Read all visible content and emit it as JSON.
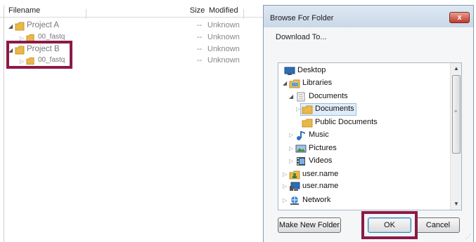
{
  "file_list": {
    "columns": {
      "filename": "Filename",
      "size": "Size",
      "modified": "Modified"
    },
    "rows": [
      {
        "name": "Project A",
        "size": "--",
        "modified": "Unknown",
        "level": 1
      },
      {
        "name": "00_fastq",
        "size": "--",
        "modified": "Unknown",
        "level": 2
      },
      {
        "name": "Project B",
        "size": "--",
        "modified": "Unknown",
        "level": 1
      },
      {
        "name": "00_fastq",
        "size": "--",
        "modified": "Unknown",
        "level": 2
      }
    ]
  },
  "dialog": {
    "title": "Browse For Folder",
    "close_label": "x",
    "description": "Download To...",
    "tree": [
      {
        "label": "Desktop",
        "icon": "desktop-icon"
      },
      {
        "label": "Libraries",
        "icon": "libraries-icon"
      },
      {
        "label": "Documents",
        "icon": "documents-library-icon"
      },
      {
        "label": "Documents",
        "icon": "folder-icon",
        "selected": true
      },
      {
        "label": "Public Documents",
        "icon": "folder-icon"
      },
      {
        "label": "Music",
        "icon": "music-icon"
      },
      {
        "label": "Pictures",
        "icon": "pictures-icon"
      },
      {
        "label": "Videos",
        "icon": "videos-icon"
      },
      {
        "label": "user.name",
        "icon": "user-folder-icon"
      },
      {
        "label": "user.name",
        "icon": "computer-icon"
      },
      {
        "label": "Network",
        "icon": "network-icon"
      }
    ],
    "buttons": {
      "new_folder": "Make New Folder",
      "ok": "OK",
      "cancel": "Cancel"
    }
  },
  "colors": {
    "highlight_box": "#8b1a48",
    "folder": "#e8b84a",
    "selection": "#e0ecfa"
  }
}
